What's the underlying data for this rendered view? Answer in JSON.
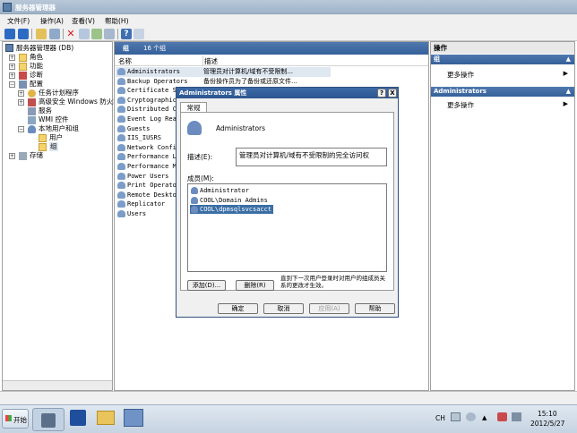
{
  "window": {
    "title": "服务器管理器"
  },
  "menu": {
    "file": "文件(F)",
    "action": "操作(A)",
    "view": "查看(V)",
    "help": "帮助(H)"
  },
  "tree": {
    "root": "服务器管理器 (DB)",
    "roles": "角色",
    "features": "功能",
    "diagnostics": "诊断",
    "config": "配置",
    "task_scheduler": "任务计划程序",
    "firewall": "高级安全 Windows 防火墙",
    "services": "服务",
    "wmi": "WMI 控件",
    "local_users": "本地用户和组",
    "users": "用户",
    "groups": "组",
    "storage": "存储"
  },
  "list": {
    "header_title": "组",
    "header_count": "16 个组",
    "col_name": "名称",
    "col_desc": "描述",
    "rows": [
      {
        "name": "Administrators",
        "desc": "管理员对计算机/域有不受限制..."
      },
      {
        "name": "Backup Operators",
        "desc": "备份操作员为了备份或还原文件..."
      },
      {
        "name": "Certificate Se",
        "desc": ""
      },
      {
        "name": "Cryptographic",
        "desc": ""
      },
      {
        "name": "Distributed CO",
        "desc": ""
      },
      {
        "name": "Event Log Read",
        "desc": ""
      },
      {
        "name": "Guests",
        "desc": ""
      },
      {
        "name": "IIS_IUSRS",
        "desc": ""
      },
      {
        "name": "Network Config",
        "desc": ""
      },
      {
        "name": "Performance Lo",
        "desc": ""
      },
      {
        "name": "Performance Mo",
        "desc": ""
      },
      {
        "name": "Power Users",
        "desc": ""
      },
      {
        "name": "Print Operator",
        "desc": ""
      },
      {
        "name": "Remote Desktop",
        "desc": ""
      },
      {
        "name": "Replicator",
        "desc": ""
      },
      {
        "name": "Users",
        "desc": ""
      }
    ]
  },
  "actions": {
    "title": "操作",
    "section1": "组",
    "more1": "更多操作",
    "section2": "Administrators",
    "more2": "更多操作"
  },
  "dialog": {
    "title": "Administrators 属性",
    "help_btn": "?",
    "close_btn": "X",
    "tab_general": "常规",
    "group_name": "Administrators",
    "desc_label": "描述(E):",
    "desc_value": "管理员对计算机/域有不受限制的完全访问权",
    "members_label": "成员(M):",
    "members": [
      "Administrator",
      "COOL\\Domain Admins",
      "COOL\\dpmsqlsvcsacct"
    ],
    "add_btn": "添加(D)...",
    "remove_btn": "删除(R)",
    "note": "直到下一次用户登录时对用户的组成员关系的更改才生效。",
    "ok": "确定",
    "cancel": "取消",
    "apply": "应用(A)",
    "help": "帮助"
  },
  "taskbar": {
    "start": "开始",
    "lang": "CH",
    "time": "15:10",
    "date": "2012/5/27"
  }
}
